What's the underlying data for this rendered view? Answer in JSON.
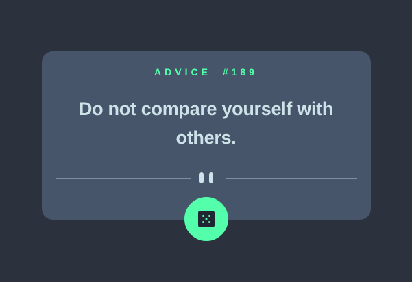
{
  "advice": {
    "label": "ADVICE",
    "number": "#189",
    "quote": "Do not compare yourself with others."
  },
  "icons": {
    "divider": "pause-icon",
    "button": "dice-icon"
  },
  "colors": {
    "background": "#2b313d",
    "card": "#465569",
    "accent": "#53ffaa",
    "text": "#cee3e9",
    "divider": "#7f8da0"
  }
}
